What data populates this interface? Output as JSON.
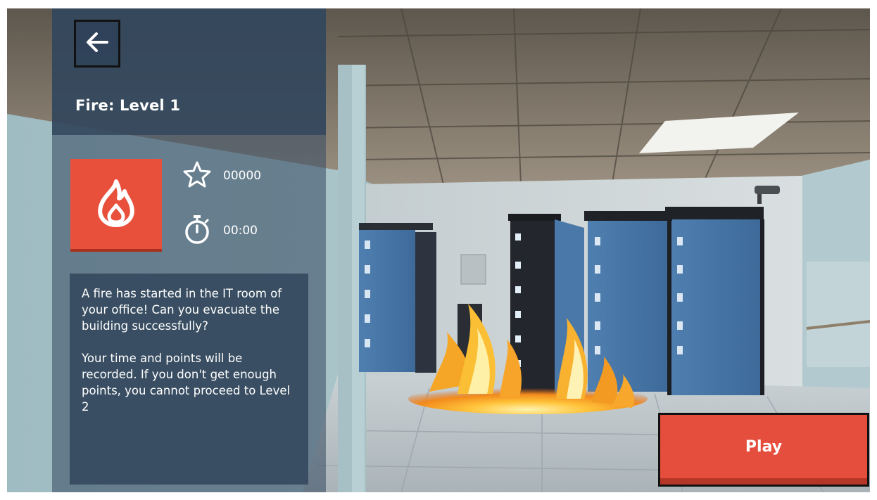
{
  "level": {
    "title": "Fire: Level 1",
    "category_icon": "fire-icon",
    "accent_color": "#e8503c"
  },
  "stats": {
    "score_icon": "star-icon",
    "score": "00000",
    "time_icon": "stopwatch-icon",
    "time": "00:00"
  },
  "description": {
    "paragraph1": "A fire has started in the IT room of your office! Can you evacuate the building successfully?",
    "paragraph2": "Your time and points will be recorded. If you don't get enough points, you cannot proceed to Level 2"
  },
  "buttons": {
    "back_icon": "back-arrow-icon",
    "play_label": "Play",
    "play_color": "#e54d3c"
  }
}
